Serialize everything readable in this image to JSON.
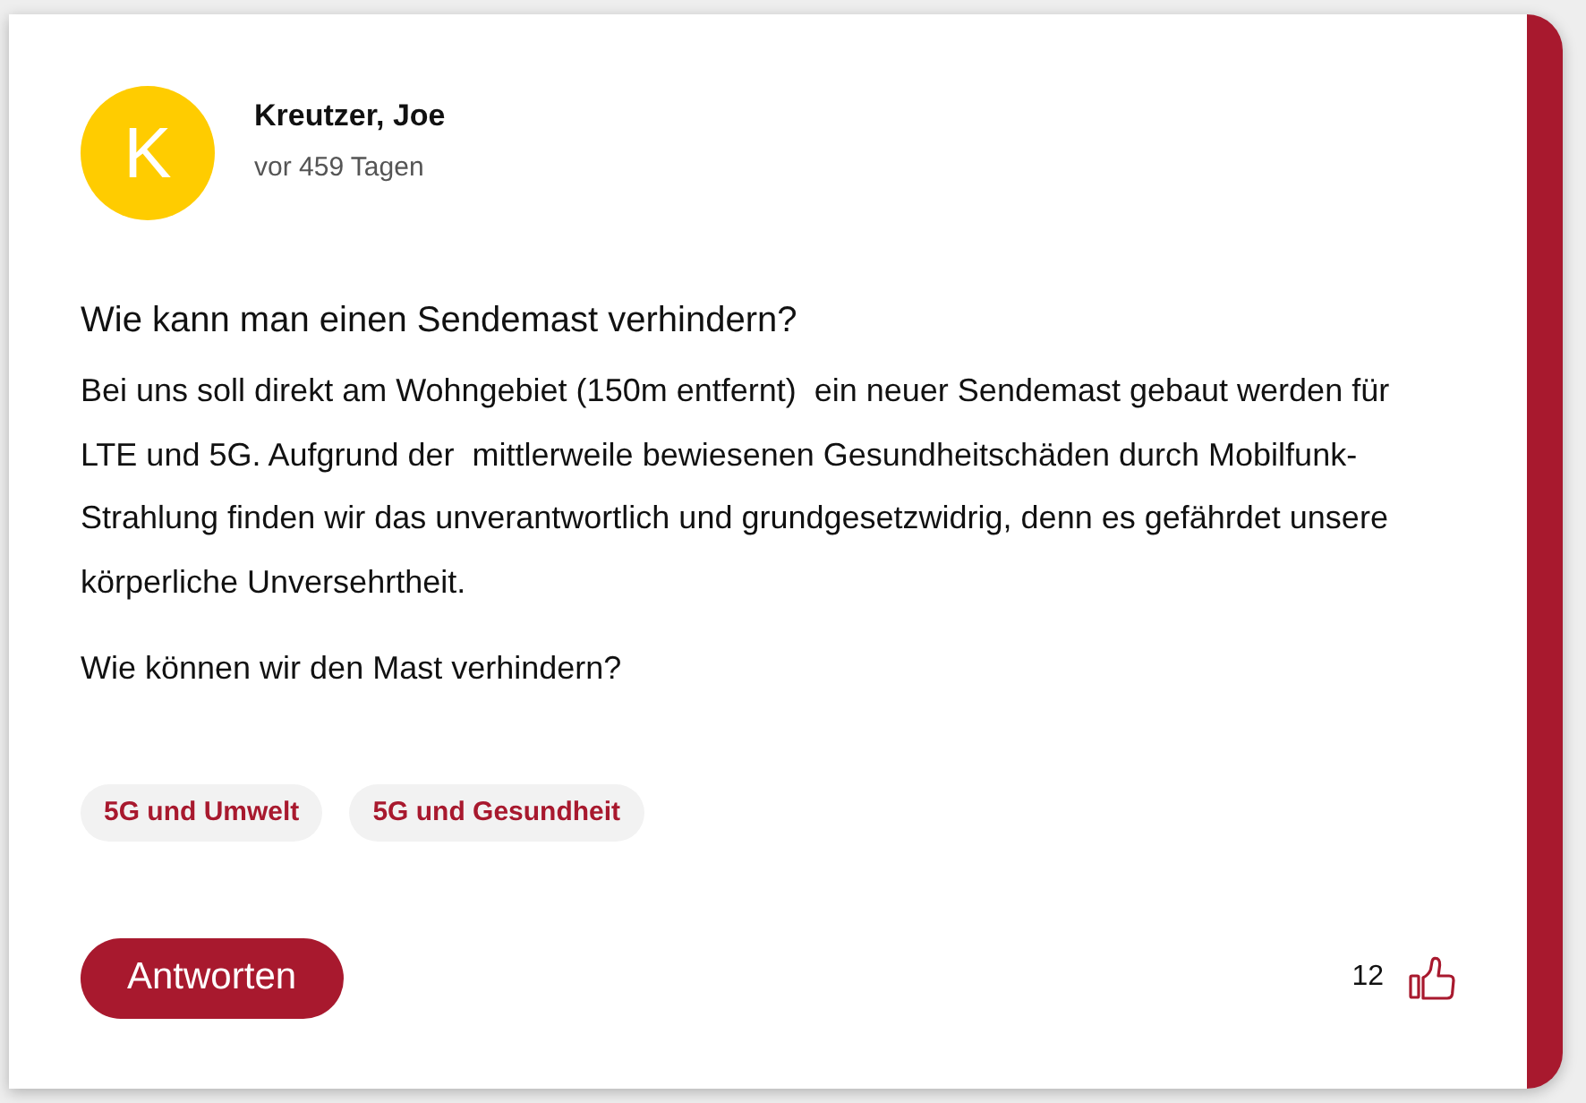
{
  "post": {
    "author": {
      "initial": "K",
      "name": "Kreutzer, Joe",
      "time": "vor 459 Tagen"
    },
    "title": "Wie kann man einen Sendemast verhindern?",
    "paragraphs": [
      "Bei uns soll direkt am Wohngebiet (150m entfernt)  ein neuer Sendemast gebaut werden für LTE und 5G. Aufgrund der  mittlerweile bewiesenen Gesundheitschäden durch Mobilfunk-Strahlung finden wir das unverantwortlich und grundgesetzwidrig, denn es gefährdet unsere körperliche Unversehrtheit.",
      "Wie können wir den Mast verhindern?"
    ],
    "tags": [
      "5G und Umwelt",
      "5G und Gesundheit"
    ],
    "reply_button": "Antworten",
    "likes": "12"
  }
}
